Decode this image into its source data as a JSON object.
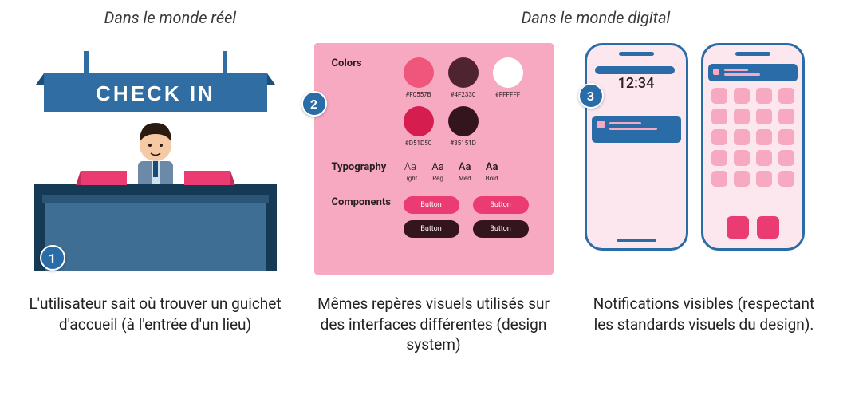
{
  "headers": {
    "left": "Dans le monde réel",
    "right": "Dans le monde digital"
  },
  "badges": {
    "p1": "1",
    "p2": "2",
    "p3": "3"
  },
  "panel1": {
    "sign_text": "CHECK IN"
  },
  "panel2": {
    "labels": {
      "colors": "Colors",
      "typography": "Typography",
      "components": "Components"
    },
    "colors": [
      {
        "hex": "#F0557B",
        "label": "#F0557B"
      },
      {
        "hex": "#4F2330",
        "label": "#4F2330"
      },
      {
        "hex": "#FFFFFF",
        "label": "#FFFFFF"
      },
      {
        "hex": "#D51D50",
        "label": "#D51D50"
      },
      {
        "hex": "#35151D",
        "label": "#35151D"
      }
    ],
    "typography": [
      {
        "sample": "Aa",
        "weight": "300",
        "label": "Light"
      },
      {
        "sample": "Aa",
        "weight": "400",
        "label": "Reg"
      },
      {
        "sample": "Aa",
        "weight": "500",
        "label": "Med"
      },
      {
        "sample": "Aa",
        "weight": "700",
        "label": "Bold"
      }
    ],
    "buttons": [
      {
        "label": "Button",
        "bg": "#ea3b72"
      },
      {
        "label": "Button",
        "bg": "#ea3b72"
      },
      {
        "label": "Button",
        "bg": "#35151D"
      },
      {
        "label": "Button",
        "bg": "#35151D"
      }
    ]
  },
  "panel3": {
    "time": "12:34"
  },
  "captions": {
    "c1": "L'utilisateur sait où trouver un guichet d'accueil (à l'entrée d'un lieu)",
    "c2": "Mêmes repères visuels utilisés sur des interfaces différentes (design system)",
    "c3": "Notifications visibles (respectant les standards visuels du design)."
  }
}
